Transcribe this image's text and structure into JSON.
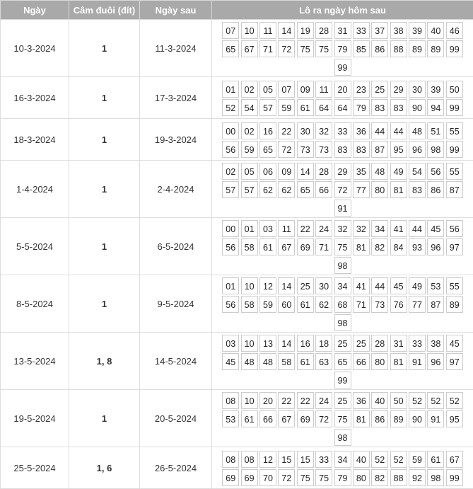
{
  "headers": {
    "date": "Ngày",
    "cam": "Câm đuôi (đít)",
    "next": "Ngày sau",
    "lo": "Lô ra ngày hôm sau"
  },
  "rows": [
    {
      "date": "10-3-2024",
      "cam": "1",
      "next": "11-3-2024",
      "lo": [
        "07",
        "10",
        "11",
        "14",
        "19",
        "28",
        "31",
        "33",
        "37",
        "38",
        "39",
        "40",
        "46",
        "65",
        "67",
        "71",
        "72",
        "75",
        "75",
        "79",
        "85",
        "86",
        "88",
        "89",
        "89",
        "99",
        "99"
      ]
    },
    {
      "date": "16-3-2024",
      "cam": "1",
      "next": "17-3-2024",
      "lo": [
        "01",
        "02",
        "05",
        "07",
        "09",
        "11",
        "20",
        "23",
        "25",
        "29",
        "30",
        "39",
        "50",
        "52",
        "54",
        "57",
        "59",
        "61",
        "64",
        "64",
        "79",
        "83",
        "83",
        "90",
        "94",
        "99"
      ]
    },
    {
      "date": "18-3-2024",
      "cam": "1",
      "next": "19-3-2024",
      "lo": [
        "00",
        "02",
        "16",
        "22",
        "30",
        "32",
        "33",
        "36",
        "44",
        "44",
        "48",
        "51",
        "55",
        "56",
        "59",
        "65",
        "72",
        "73",
        "73",
        "83",
        "83",
        "87",
        "95",
        "96",
        "98",
        "99"
      ]
    },
    {
      "date": "1-4-2024",
      "cam": "1",
      "next": "2-4-2024",
      "lo": [
        "02",
        "05",
        "06",
        "09",
        "14",
        "28",
        "29",
        "35",
        "48",
        "49",
        "54",
        "56",
        "55",
        "57",
        "57",
        "62",
        "62",
        "65",
        "66",
        "72",
        "77",
        "80",
        "81",
        "83",
        "86",
        "87",
        "91"
      ]
    },
    {
      "date": "5-5-2024",
      "cam": "1",
      "next": "6-5-2024",
      "lo": [
        "00",
        "01",
        "03",
        "11",
        "22",
        "24",
        "32",
        "32",
        "34",
        "41",
        "44",
        "45",
        "56",
        "56",
        "58",
        "61",
        "67",
        "69",
        "71",
        "75",
        "81",
        "82",
        "84",
        "93",
        "96",
        "97",
        "98"
      ]
    },
    {
      "date": "8-5-2024",
      "cam": "1",
      "next": "9-5-2024",
      "lo": [
        "01",
        "10",
        "12",
        "14",
        "25",
        "30",
        "34",
        "41",
        "44",
        "45",
        "49",
        "53",
        "55",
        "56",
        "58",
        "59",
        "60",
        "61",
        "62",
        "68",
        "71",
        "73",
        "76",
        "77",
        "87",
        "89",
        "98"
      ]
    },
    {
      "date": "13-5-2024",
      "cam": "1, 8",
      "next": "14-5-2024",
      "lo": [
        "03",
        "10",
        "13",
        "14",
        "16",
        "18",
        "25",
        "25",
        "28",
        "31",
        "33",
        "38",
        "45",
        "45",
        "48",
        "48",
        "58",
        "61",
        "63",
        "65",
        "66",
        "80",
        "81",
        "91",
        "96",
        "97",
        "99"
      ]
    },
    {
      "date": "19-5-2024",
      "cam": "1",
      "next": "20-5-2024",
      "lo": [
        "08",
        "10",
        "20",
        "22",
        "22",
        "24",
        "25",
        "36",
        "40",
        "50",
        "52",
        "52",
        "52",
        "53",
        "61",
        "66",
        "67",
        "69",
        "72",
        "75",
        "81",
        "86",
        "89",
        "90",
        "91",
        "95",
        "98"
      ]
    },
    {
      "date": "25-5-2024",
      "cam": "1, 6",
      "next": "26-5-2024",
      "lo": [
        "08",
        "08",
        "12",
        "15",
        "15",
        "33",
        "34",
        "40",
        "52",
        "52",
        "59",
        "61",
        "67",
        "69",
        "69",
        "70",
        "72",
        "75",
        "75",
        "79",
        "80",
        "82",
        "88",
        "92",
        "98",
        "99"
      ]
    }
  ]
}
